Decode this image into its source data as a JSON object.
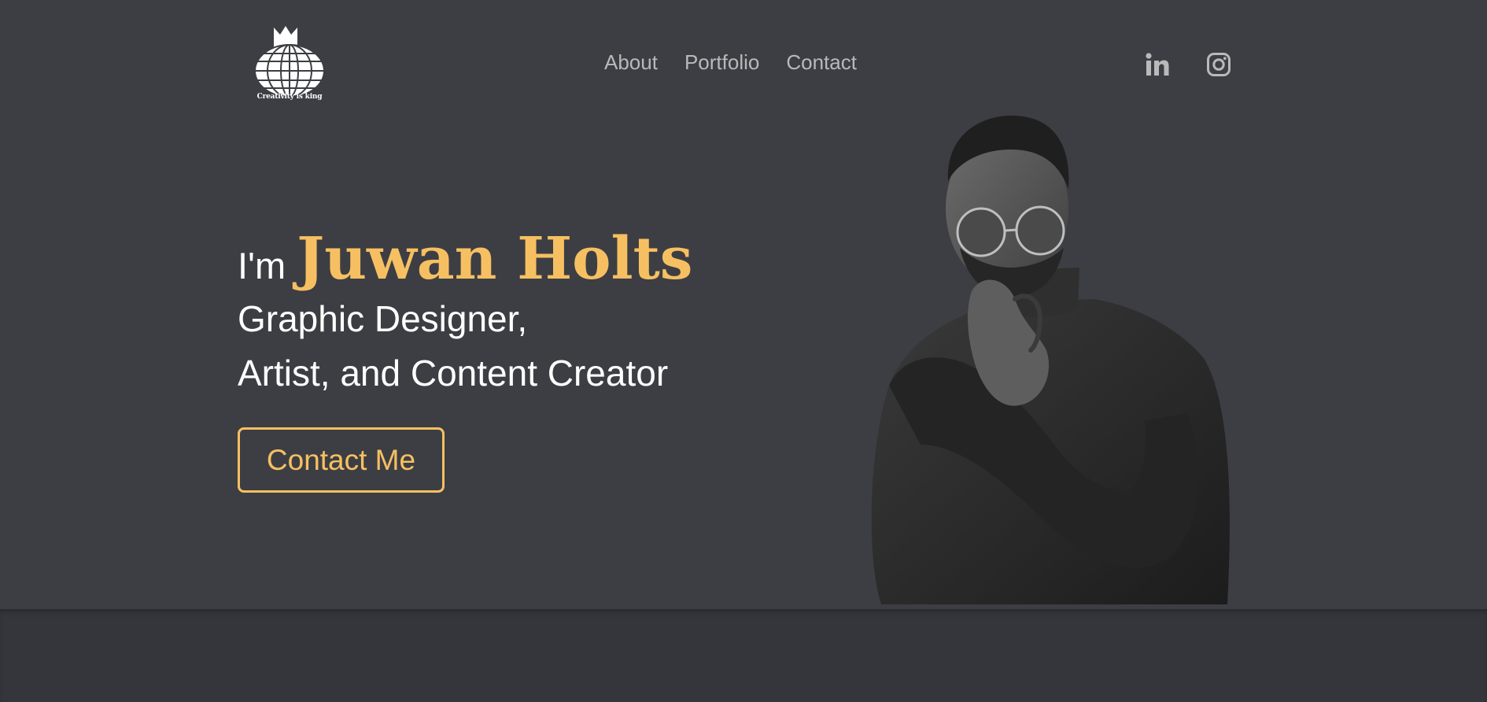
{
  "brand": {
    "logo_text": "Creativity is king"
  },
  "nav": {
    "items": [
      "About",
      "Portfolio",
      "Contact"
    ]
  },
  "social": {
    "icons": [
      "linkedin-icon",
      "instagram-icon"
    ]
  },
  "hero": {
    "intro": "I'm",
    "name": "Juwan Holts",
    "role_line1": "Graphic Designer,",
    "role_line2": "Artist, and Content Creator",
    "cta_label": "Contact Me"
  },
  "colors": {
    "background": "#3d3e43",
    "lower_background": "#35363c",
    "accent": "#f6c062",
    "nav_text": "#b9b9bb",
    "text": "#ffffff"
  }
}
